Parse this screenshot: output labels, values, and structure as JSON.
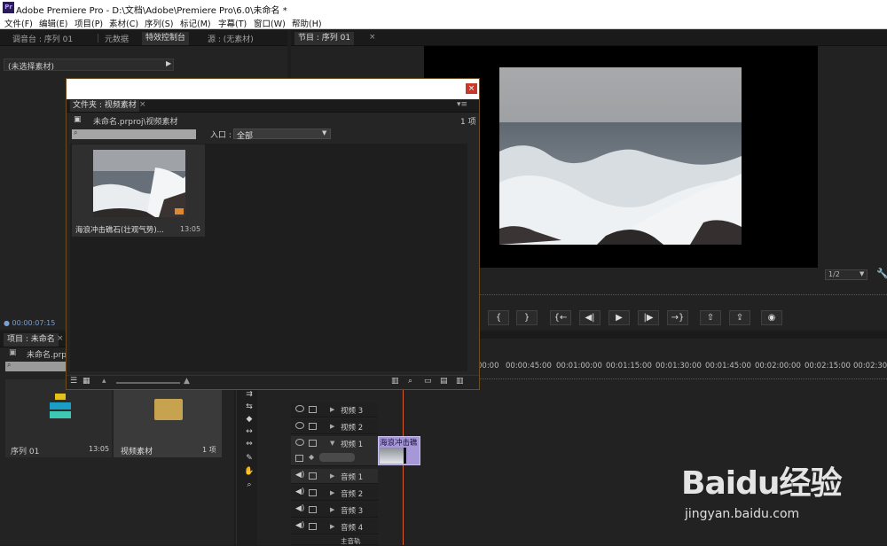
{
  "window": {
    "title": "Adobe Premiere Pro - D:\\文档\\Adobe\\Premiere Pro\\6.0\\未命名 *",
    "logo": "Pr"
  },
  "menu": [
    "文件(F)",
    "编辑(E)",
    "项目(P)",
    "素材(C)",
    "序列(S)",
    "标记(M)",
    "字幕(T)",
    "窗口(W)",
    "帮助(H)"
  ],
  "left_top": {
    "tabs": [
      "调音台 : 序列 01",
      "元数据",
      "特效控制台",
      "源 : (无素材)"
    ],
    "no_clip": "(未选择素材)",
    "timecode": "00:00:07:15"
  },
  "program": {
    "tab": "节目 : 序列 01",
    "zoom": "1/2"
  },
  "dialog": {
    "tab": "文件夹 : 视频素材",
    "path": "未命名.prproj\\视频素材",
    "count": "1 项",
    "search_placeholder": "",
    "entry_label": "入口 :",
    "entry_value": "全部",
    "clip_name": "海浪冲击礁石(壮观气势)...",
    "clip_duration": "13:05"
  },
  "project": {
    "tab": "项目 : 未命名",
    "file": "未命名.prpr",
    "items": [
      {
        "name": "序列 01",
        "info": "13:05"
      },
      {
        "name": "视频素材",
        "info": "1 项"
      }
    ]
  },
  "timeline": {
    "ruler": [
      "00:00",
      "00:00:45:00",
      "00:01:00:00",
      "00:01:15:00",
      "00:01:30:00",
      "00:01:45:00",
      "00:02:00:00",
      "00:02:15:00",
      "00:02:30"
    ],
    "video_tracks": [
      "视频 3",
      "视频 2",
      "视频 1"
    ],
    "audio_tracks": [
      "音频 1",
      "音频 2",
      "音频 3",
      "音频 4"
    ],
    "master": "主音轨",
    "clip_label": "海浪冲击礁"
  },
  "watermark": {
    "brand": "Baidu经验",
    "url": "jingyan.baidu.com"
  }
}
